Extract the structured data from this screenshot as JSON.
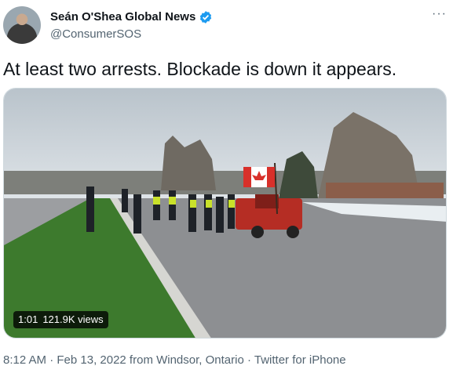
{
  "author": {
    "display_name": "Seán O'Shea Global News",
    "handle": "@ConsumerSOS",
    "verified": true
  },
  "more_label": "···",
  "tweet": {
    "text": "At least two arrests. Blockade is down it appears."
  },
  "video": {
    "duration": "1:01",
    "views": "121.9K views"
  },
  "meta": {
    "line": "8:12 AM · Feb 13, 2022 from Windsor, Ontario · Twitter for iPhone"
  },
  "colors": {
    "text": "#0f1419",
    "secondary": "#536471",
    "verified": "#1d9bf0"
  }
}
